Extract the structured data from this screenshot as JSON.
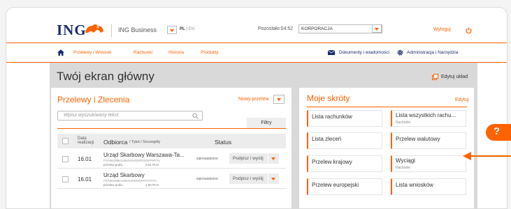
{
  "header": {
    "logo_text": "ING",
    "app_name": "ING Business",
    "lang_active": "PL",
    "lang_sep": "|",
    "lang_other": "EN",
    "timer": "Pozostało:04:52",
    "company_select_value": "KORPORACJA",
    "logout_label": "Wyloguj"
  },
  "nav": {
    "items": [
      "Przelewy i Wnioski",
      "Rachunki",
      "Historia",
      "Produkty"
    ],
    "right_items": [
      "Dokumenty i wiadomości",
      "Administracja i Narzędzia"
    ]
  },
  "main": {
    "title": "Twój ekran główny",
    "edit_layout_label": "Edytuj układ"
  },
  "transfers": {
    "title": "Przelewy i Zlecenia",
    "new_transfer_label": "Nowy przelew",
    "search_placeholder": "Wpisz wyszukiwany tekst",
    "filters_label": "Filtry",
    "columns": {
      "date": "Data realizacji",
      "recipient": "Odbiorca",
      "recipient_sub": "/ Tytuł / Szczegóły",
      "status": "Status"
    },
    "rows": [
      {
        "date": "16.01",
        "name": "Urząd Skarbowy Warszawa-Ta...",
        "meta": "/TI/N55298e1095/OKR/20P02/SFP/PIT5",
        "sub": "przelew poda...",
        "amount": "0,01 PLN",
        "status": "wprowadzone",
        "action": "Podpisz i wyślij"
      },
      {
        "date": "16.01",
        "name": "Urząd Skarbowy",
        "meta": "/TI/N55298e1095/OKR/0/SFP/VAT/TX...",
        "sub": "przelew poda...",
        "amount": "1,00 PLN",
        "status": "wprowadzone",
        "action": "Podpisz i wyślij"
      }
    ]
  },
  "shortcuts": {
    "title": "Moje skróty",
    "edit_label": "Edytuj",
    "items": [
      {
        "label": "Lista rachunków",
        "sub": ""
      },
      {
        "label": "Lista wszystkich rachu...",
        "sub": "Rachunki"
      },
      {
        "label": "Lista zleceń",
        "sub": ""
      },
      {
        "label": "Przelew walutowy",
        "sub": ""
      },
      {
        "label": "Przelew krajowy",
        "sub": ""
      },
      {
        "label": "Wyciągi",
        "sub": "Rachunki"
      },
      {
        "label": "Przelew europejski",
        "sub": ""
      },
      {
        "label": "Lista wniosków",
        "sub": ""
      }
    ]
  },
  "help": {
    "label": "?"
  },
  "colors": {
    "accent": "#ff6200",
    "brand": "#1a2c6c",
    "panel_bg": "#d9d9d9"
  }
}
